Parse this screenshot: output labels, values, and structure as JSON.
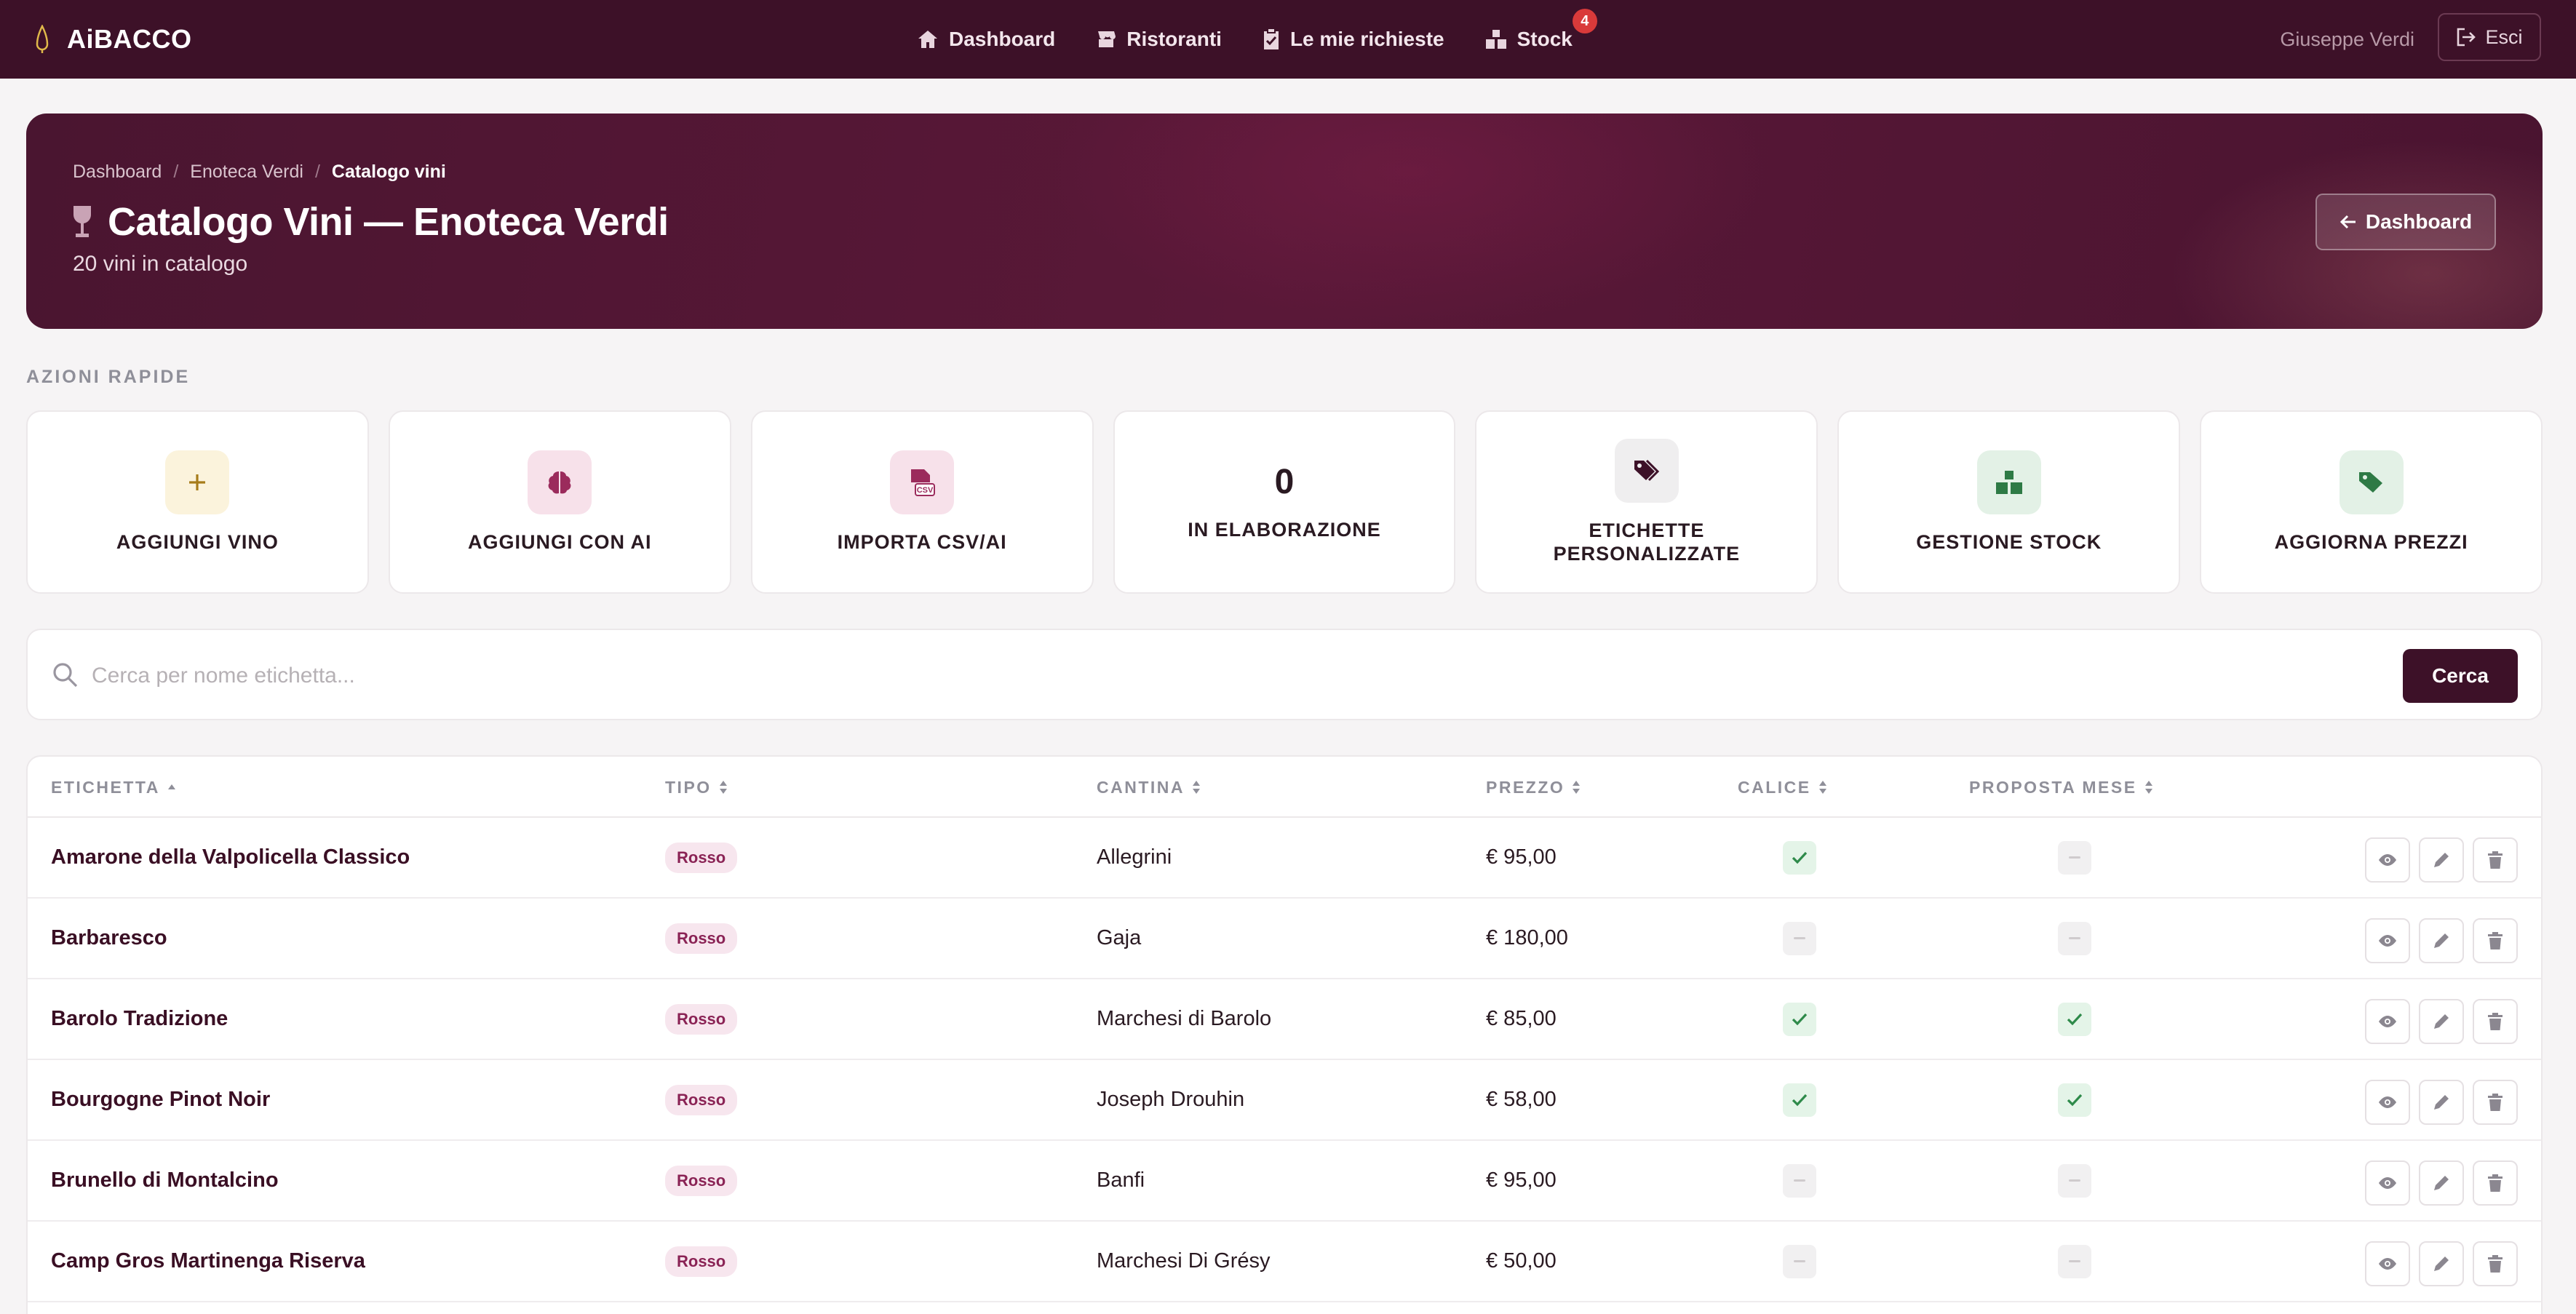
{
  "navbar": {
    "brand": "AiBACCO",
    "links": [
      {
        "label": "Dashboard",
        "icon": "home-icon"
      },
      {
        "label": "Ristoranti",
        "icon": "store-icon"
      },
      {
        "label": "Le mie richieste",
        "icon": "clipboard-check-icon"
      },
      {
        "label": "Stock",
        "icon": "boxes-icon",
        "badge": "4"
      }
    ],
    "user": "Giuseppe Verdi",
    "logout_label": "Esci"
  },
  "hero": {
    "breadcrumb": [
      "Dashboard",
      "Enoteca Verdi",
      "Catalogo vini"
    ],
    "breadcrumb_sep": "/",
    "title": "Catalogo Vini — Enoteca Verdi",
    "subtitle": "20 vini in catalogo",
    "back_button": "Dashboard"
  },
  "quick_actions": {
    "section_label": "AZIONI RAPIDE",
    "items": [
      {
        "label": "AGGIUNGI VINO",
        "icon": "plus-icon"
      },
      {
        "label": "AGGIUNGI CON AI",
        "icon": "brain-icon"
      },
      {
        "label": "IMPORTA CSV/AI",
        "icon": "csv-file-icon"
      },
      {
        "label": "IN ELABORAZIONE",
        "count": "0"
      },
      {
        "label": "ETICHETTE PERSONALIZZATE",
        "icon": "tags-icon"
      },
      {
        "label": "GESTIONE STOCK",
        "icon": "boxes-icon"
      },
      {
        "label": "AGGIORNA PREZZI",
        "icon": "price-tag-icon"
      }
    ]
  },
  "search": {
    "placeholder": "Cerca per nome etichetta...",
    "value": "",
    "button": "Cerca"
  },
  "table": {
    "columns": [
      "ETICHETTA",
      "TIPO",
      "CANTINA",
      "PREZZO",
      "CALICE",
      "PROPOSTA MESE"
    ],
    "rows": [
      {
        "etichetta": "Amarone della Valpolicella Classico",
        "tipo": "Rosso",
        "cantina": "Allegrini",
        "prezzo": "€ 95,00",
        "calice": true,
        "proposta": false
      },
      {
        "etichetta": "Barbaresco",
        "tipo": "Rosso",
        "cantina": "Gaja",
        "prezzo": "€ 180,00",
        "calice": false,
        "proposta": false
      },
      {
        "etichetta": "Barolo Tradizione",
        "tipo": "Rosso",
        "cantina": "Marchesi di Barolo",
        "prezzo": "€ 85,00",
        "calice": true,
        "proposta": true
      },
      {
        "etichetta": "Bourgogne Pinot Noir",
        "tipo": "Rosso",
        "cantina": "Joseph Drouhin",
        "prezzo": "€ 58,00",
        "calice": true,
        "proposta": true
      },
      {
        "etichetta": "Brunello di Montalcino",
        "tipo": "Rosso",
        "cantina": "Banfi",
        "prezzo": "€ 95,00",
        "calice": false,
        "proposta": false
      },
      {
        "etichetta": "Camp Gros Martinenga Riserva",
        "tipo": "Rosso",
        "cantina": "Marchesi Di Grésy",
        "prezzo": "€ 50,00",
        "calice": false,
        "proposta": false
      }
    ]
  },
  "colors": {
    "brand": "#3d1128",
    "check_green": "#2e8a4a",
    "badge_red": "#d93a3a"
  }
}
